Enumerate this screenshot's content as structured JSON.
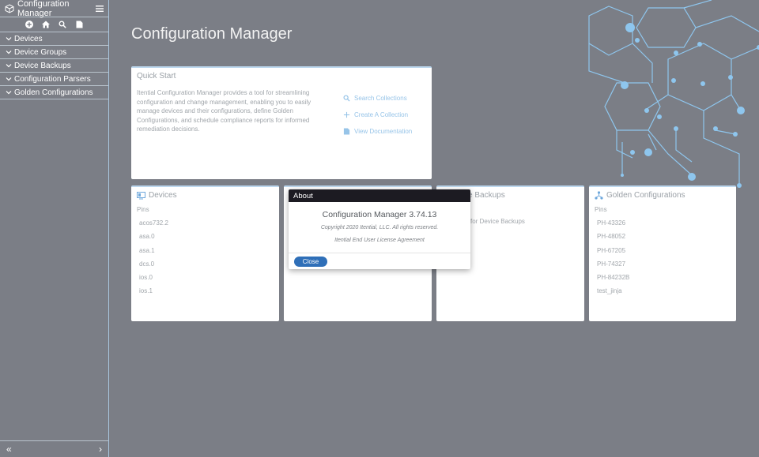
{
  "sidebar": {
    "title": "Configuration Manager",
    "tools": [
      "add-icon",
      "home-icon",
      "search-icon",
      "document-icon"
    ],
    "items": [
      {
        "label": "Devices"
      },
      {
        "label": "Device Groups"
      },
      {
        "label": "Device Backups"
      },
      {
        "label": "Configuration Parsers"
      },
      {
        "label": "Golden Configurations"
      }
    ],
    "footer": {
      "collapse": "«",
      "expand": "›"
    }
  },
  "main": {
    "title": "Configuration Manager",
    "quick_start": {
      "title": "Quick Start",
      "description": "Itential Configuration Manager provides a tool for streamlining configuration and change management, enabling you to easily manage devices and their configurations, define Golden Configurations, and schedule compliance reports for informed remediation decisions.",
      "links": [
        {
          "label": "Search Collections",
          "icon": "search-icon"
        },
        {
          "label": "Create A Collection",
          "icon": "plus-icon"
        },
        {
          "label": "View Documentation",
          "icon": "document-icon"
        }
      ]
    },
    "devices": {
      "title": "Devices",
      "pins_label": "Pins",
      "pins": [
        "acos732.2",
        "asa.0",
        "asa.1",
        "dcs.0",
        "ios.0",
        "ios.1"
      ]
    },
    "device_backups": {
      "title": "e Backups",
      "empty": "for Device Backups"
    },
    "golden": {
      "title": "Golden Configurations",
      "pins_label": "Pins",
      "pins": [
        "PH-43326",
        "PH-48052",
        "PH-67205",
        "PH-74327",
        "PH-84232B",
        "test_jinja"
      ]
    }
  },
  "modal": {
    "title": "About",
    "version": "Configuration Manager 3.74.13",
    "copyright": "Copyright 2020 Itential, LLC. All rights reserved.",
    "eula": "Itential End User License Agreement",
    "close": "Close"
  },
  "colors": {
    "accent": "#2f6fb8",
    "link": "#97c4e8",
    "overlay": "#7b7e86",
    "modal_header": "#1c1b22"
  }
}
